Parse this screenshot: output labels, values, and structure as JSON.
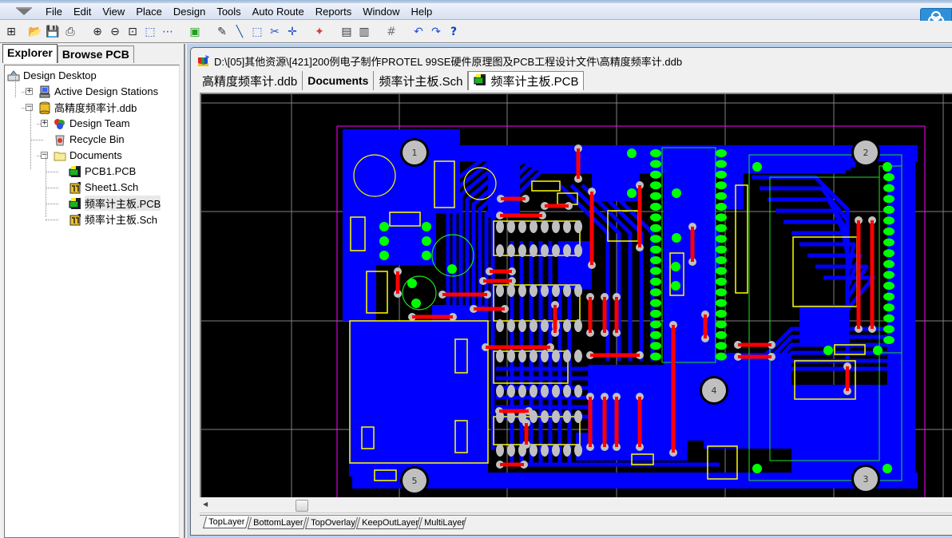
{
  "menubar": {
    "items": [
      "File",
      "Edit",
      "View",
      "Place",
      "Design",
      "Tools",
      "Auto Route",
      "Reports",
      "Window",
      "Help"
    ]
  },
  "toolbar": {
    "buttons": [
      {
        "name": "design-manager",
        "glyph": "⊞"
      },
      {
        "name": "open",
        "glyph": "📂"
      },
      {
        "name": "save",
        "glyph": "💾"
      },
      {
        "name": "print",
        "glyph": "⎙"
      },
      {
        "name": "zoom-in",
        "glyph": "⊕"
      },
      {
        "name": "zoom-out",
        "glyph": "⊖"
      },
      {
        "name": "zoom-fit",
        "glyph": "⊡"
      },
      {
        "name": "zoom-area",
        "glyph": "⬚"
      },
      {
        "name": "zoom-last",
        "glyph": "⋯"
      },
      {
        "name": "component-browser",
        "glyph": "▣"
      },
      {
        "name": "interactive-route",
        "glyph": "✎"
      },
      {
        "name": "place-line",
        "glyph": "╲"
      },
      {
        "name": "select-area",
        "glyph": "⬚"
      },
      {
        "name": "deselect",
        "glyph": "✂"
      },
      {
        "name": "move",
        "glyph": "✛"
      },
      {
        "name": "cross-probe",
        "glyph": "✦"
      },
      {
        "name": "library-1",
        "glyph": "▤"
      },
      {
        "name": "library-2",
        "glyph": "▥"
      },
      {
        "name": "grid",
        "glyph": "#"
      },
      {
        "name": "undo",
        "glyph": "↶"
      },
      {
        "name": "redo",
        "glyph": "↷"
      },
      {
        "name": "help",
        "glyph": "?"
      }
    ]
  },
  "explorer": {
    "tabs": [
      "Explorer",
      "Browse PCB"
    ],
    "active_tab": "Explorer",
    "tree": [
      {
        "label": "Design Desktop",
        "icon": "desktop-icon",
        "level": 0
      },
      {
        "label": "Active Design Stations",
        "icon": "workstation-icon",
        "level": 1,
        "expander": "+"
      },
      {
        "label": "高精度频率计.ddb",
        "icon": "database-icon",
        "level": 1,
        "expander": "-"
      },
      {
        "label": "Design Team",
        "icon": "team-icon",
        "level": 2,
        "expander": "+"
      },
      {
        "label": "Recycle Bin",
        "icon": "recycle-bin-icon",
        "level": 2
      },
      {
        "label": "Documents",
        "icon": "folder-icon",
        "level": 2,
        "expander": "-"
      },
      {
        "label": "PCB1.PCB",
        "icon": "pcb-doc-icon",
        "level": 3
      },
      {
        "label": "Sheet1.Sch",
        "icon": "sch-doc-icon",
        "level": 3
      },
      {
        "label": "频率计主板.PCB",
        "icon": "pcb-doc-icon",
        "level": 3,
        "selected": true
      },
      {
        "label": "频率计主板.Sch",
        "icon": "sch-doc-icon",
        "level": 3
      }
    ]
  },
  "document": {
    "path": "D:\\[05]其他资源\\[421]200例电子制作PROTEL 99SE硬件原理图及PCB工程设计文件\\高精度频率计.ddb",
    "tabs": [
      {
        "label": "高精度频率计.ddb",
        "active": false
      },
      {
        "label": "Documents",
        "active": false
      },
      {
        "label": "频率计主板.Sch",
        "active": false
      },
      {
        "label": "频率计主板.PCB",
        "active": true
      }
    ],
    "layer_tabs": [
      "TopLayer",
      "BottomLayer",
      "TopOverlay",
      "KeepOutLayer",
      "MultiLayer"
    ],
    "active_layer": "TopLayer",
    "mounting_holes": [
      "1",
      "2",
      "3",
      "4",
      "5"
    ]
  },
  "colors": {
    "canvas_bg": "#000000",
    "grid": "#808080",
    "board_outline": "#ff00ff",
    "bottom_layer": "#0000ff",
    "top_layer": "#ff0000",
    "top_overlay": "#ffff00",
    "multilayer_pad": "#c0c0c0",
    "pad_green": "#00ff00"
  }
}
